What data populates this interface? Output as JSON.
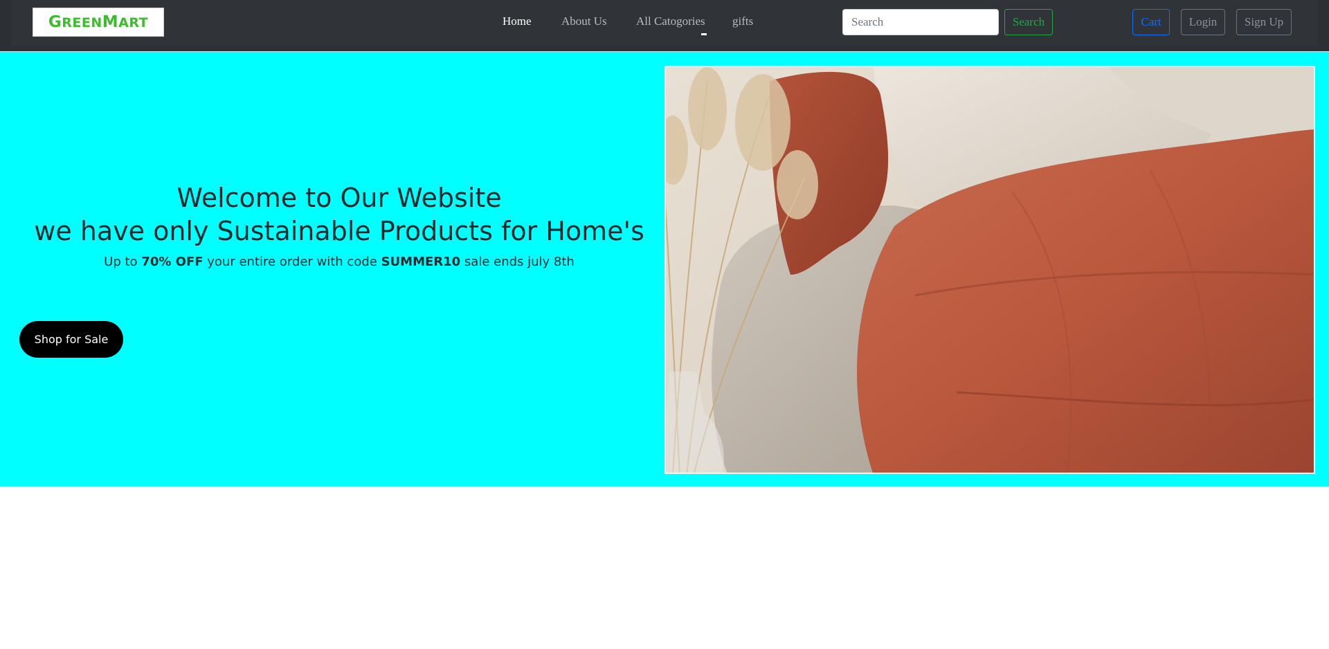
{
  "brand": {
    "logo_part1": "G",
    "logo_part2": "REEN",
    "logo_part3": "M",
    "logo_part4": "ART",
    "logo_color": "#3cbd2e"
  },
  "nav": {
    "items": [
      {
        "label": "Home",
        "active": true
      },
      {
        "label": "About Us",
        "active": false
      },
      {
        "label": "All Catogories",
        "active": false
      },
      {
        "label": "gifts",
        "active": false
      }
    ]
  },
  "search": {
    "placeholder": "Search",
    "button_label": "Search"
  },
  "account": {
    "cart_label": "Cart",
    "login_label": "Login",
    "signup_label": "Sign Up"
  },
  "hero": {
    "title_line1": "Welcome to Our Website",
    "title_line2": "we have only Sustainable Products for Home's",
    "sub_prefix": "Up to ",
    "sub_discount": "70% OFF",
    "sub_middle": " your entire order with code ",
    "sub_code": "SUMMER10",
    "sub_suffix": " sale ends july 8th",
    "cta_label": "Shop for Sale",
    "background_color": "#00ffff",
    "image_alt": "bedroom-linen-photo"
  },
  "colors": {
    "navbar": "#2c2f33",
    "search_button": "#28a745",
    "cart_button": "#0d6efd",
    "muted_button": "#6c757d"
  }
}
